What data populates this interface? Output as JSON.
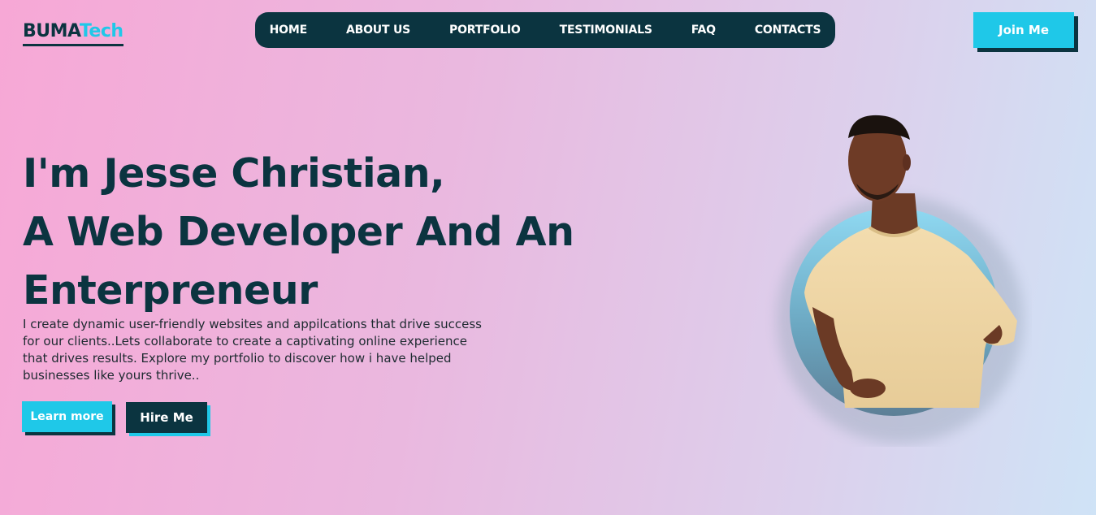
{
  "brand": {
    "part1": "BUMA",
    "part2": "Tech"
  },
  "nav": {
    "items": [
      {
        "label": "HOME"
      },
      {
        "label": "ABOUT US"
      },
      {
        "label": "PORTFOLIO"
      },
      {
        "label": "TESTIMONIALS"
      },
      {
        "label": "FAQ"
      },
      {
        "label": "CONTACTS"
      }
    ]
  },
  "header": {
    "join_label": "Join Me"
  },
  "hero": {
    "line1": "I'm Jesse Christian,",
    "line2": "A Web Developer And An",
    "line3": "Enterpreneur",
    "description": "I create dynamic user-friendly websites and appilcations that drive success for our clients..Lets collaborate to create a captivating online experience that drives results. Explore my portfolio to discover how i have helped businesses like yours thrive..",
    "learn_label": "Learn more",
    "hire_label": "Hire Me"
  },
  "colors": {
    "primary_dark": "#0b3440",
    "accent_cyan": "#1fc8e8",
    "bg_pink": "#f7a8d6",
    "bg_blue": "#cfe3f6"
  }
}
